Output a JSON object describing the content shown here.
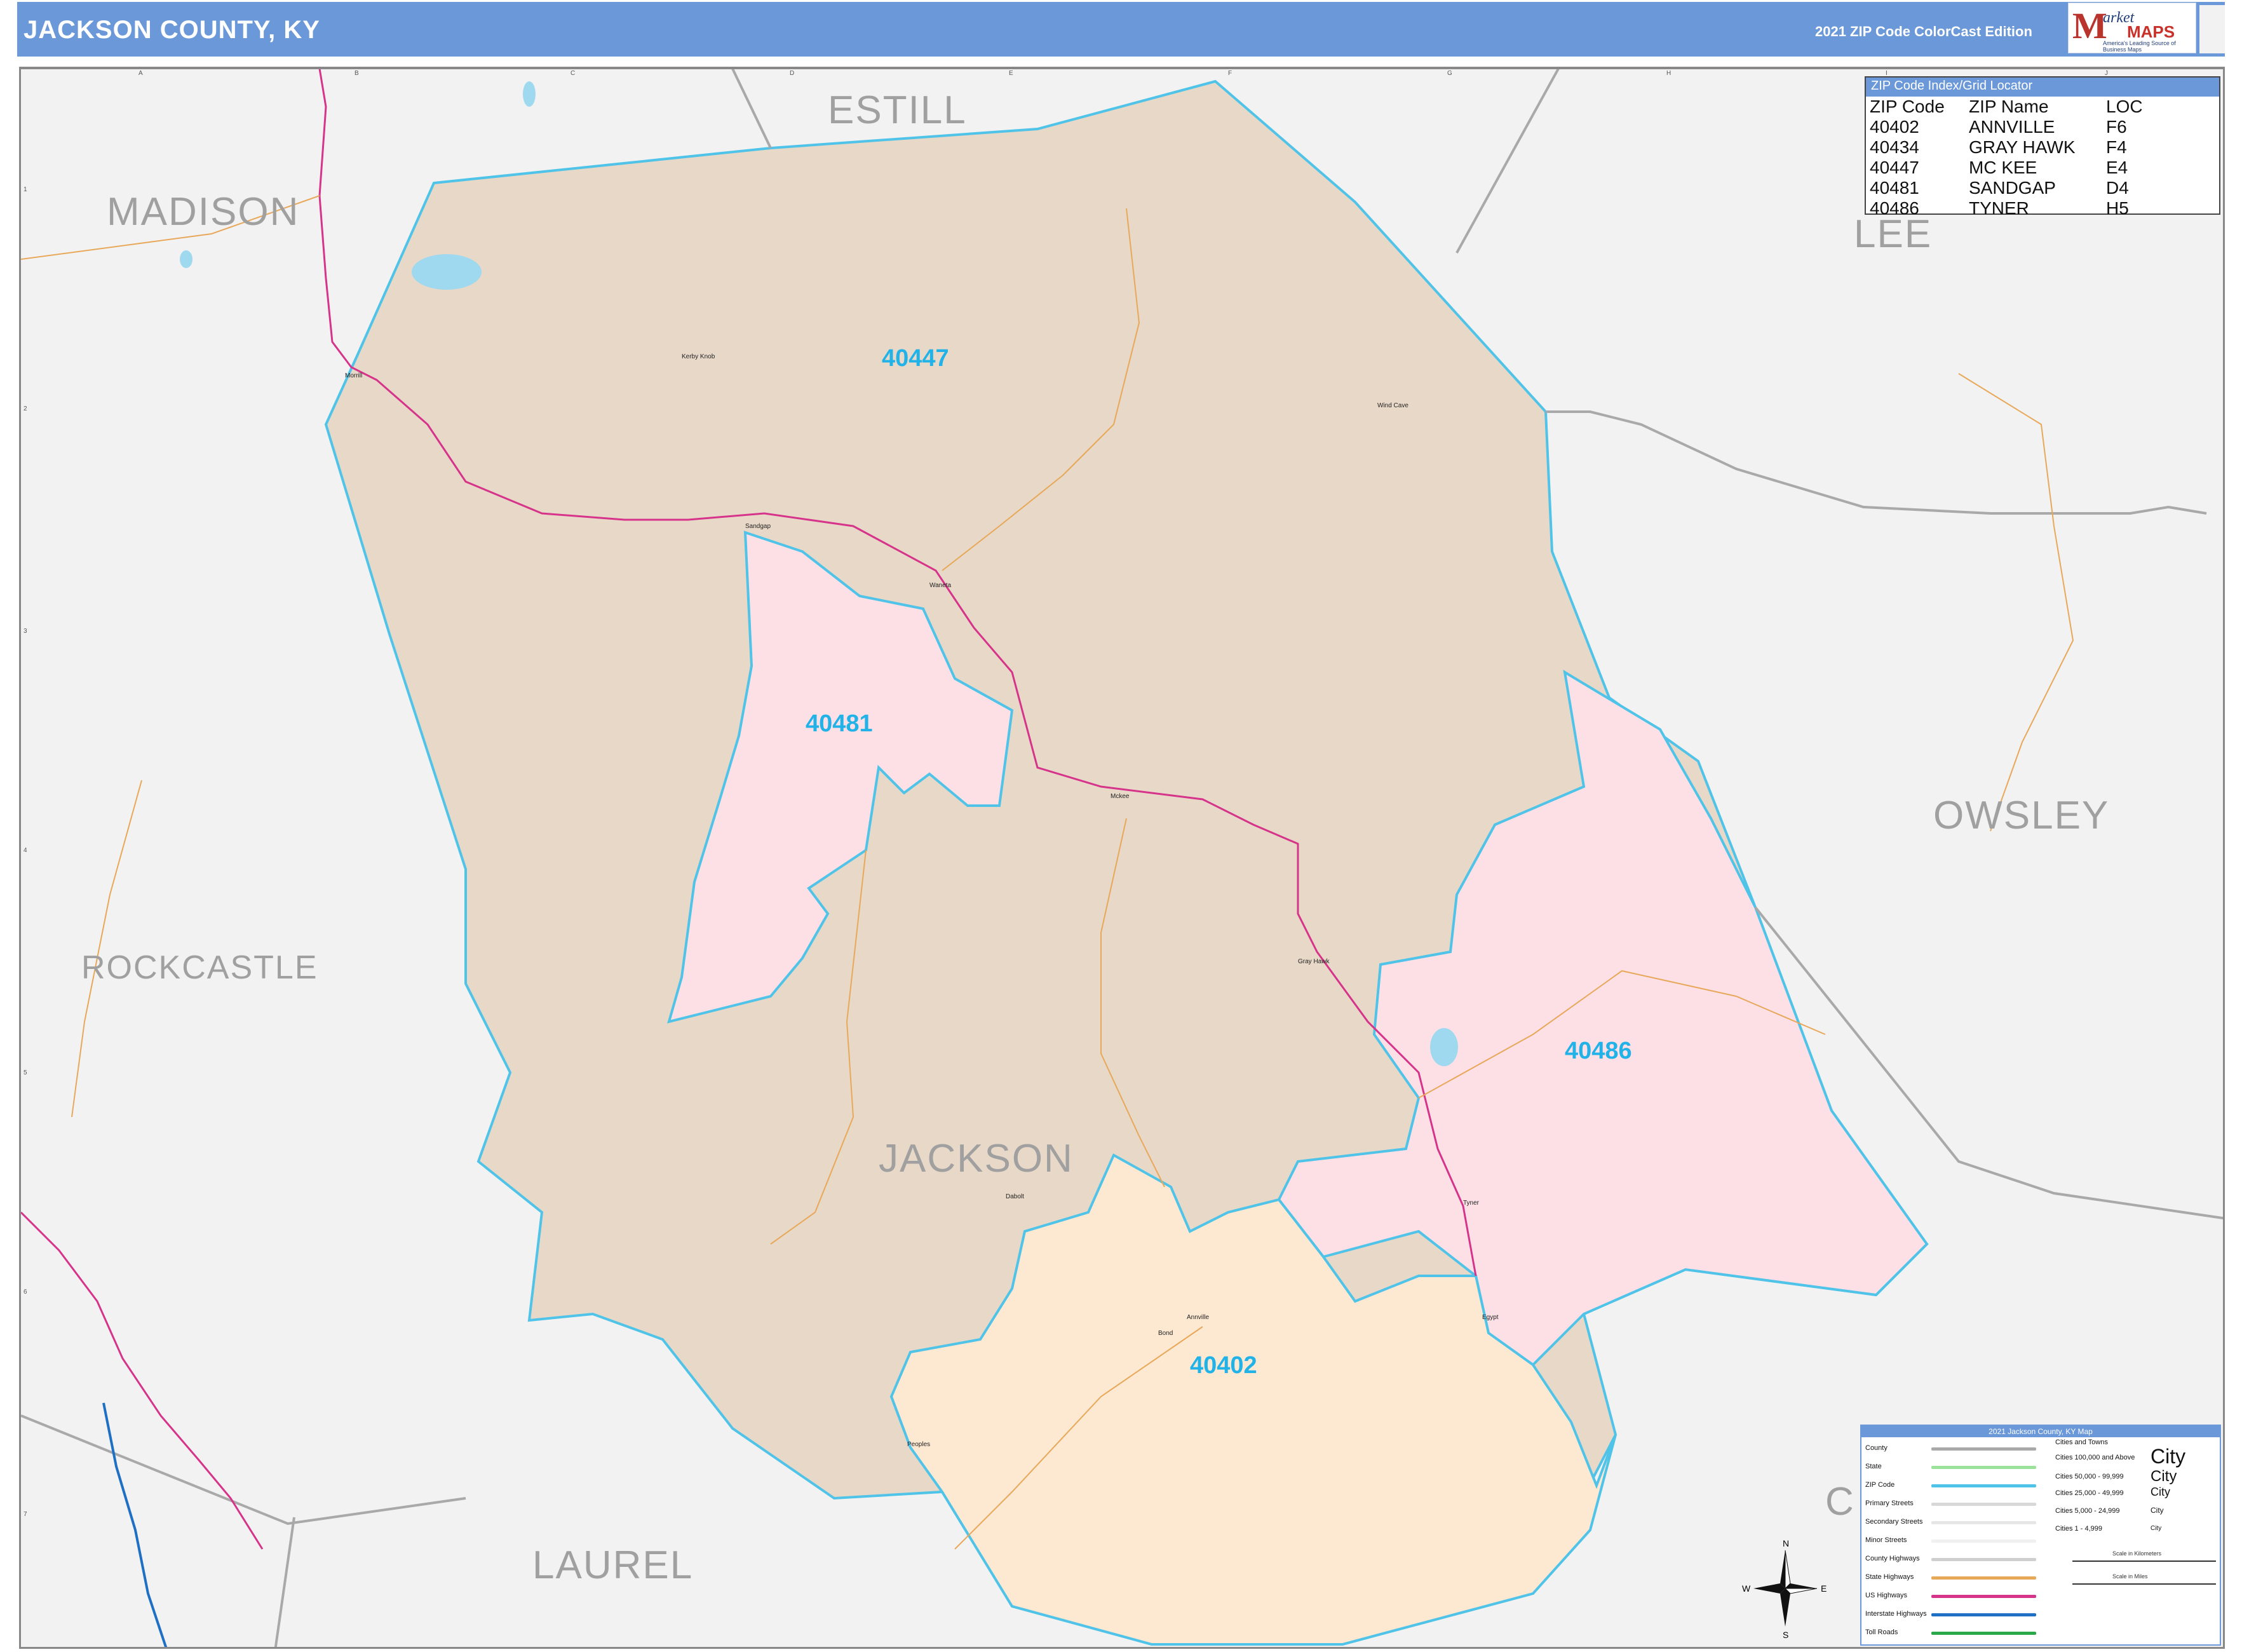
{
  "header": {
    "title": "JACKSON COUNTY, KY",
    "edition": "2021 ZIP Code ColorCast Edition",
    "logo_initial": "M",
    "logo_word1": "arket",
    "logo_word2": "MAPS",
    "logo_tagline": "America's Leading Source of Business Maps"
  },
  "grid": {
    "columns": [
      "A",
      "B",
      "C",
      "D",
      "E",
      "F",
      "G",
      "H",
      "I",
      "J"
    ],
    "rows": [
      "1",
      "2",
      "3",
      "4",
      "5",
      "6",
      "7"
    ]
  },
  "counties": {
    "jackson": "JACKSON",
    "madison": "MADISON",
    "estill": "ESTILL",
    "lee": "LEE",
    "owsley": "OWSLEY",
    "rockcastle": "ROCKCASTLE",
    "laurel": "LAUREL",
    "clay": "C"
  },
  "zips": [
    {
      "code": "40447",
      "name": "MC KEE",
      "color": "#e8d8c8"
    },
    {
      "code": "40481",
      "name": "SANDGAP",
      "color": "#fde0e6"
    },
    {
      "code": "40486",
      "name": "TYNER",
      "color": "#fde0e6"
    },
    {
      "code": "40402",
      "name": "ANNVILLE",
      "color": "#fde8d2"
    }
  ],
  "places": {
    "kerby_knob": "Kerby Knob",
    "wind_cave": "Wind Cave",
    "sandgap": "Sandgap",
    "waneta": "Waneta",
    "mckee": "Mckee",
    "gray_hawk": "Gray Hawk",
    "tyner": "Tyner",
    "egypt": "Egypt",
    "annville": "Annville",
    "bond": "Bond",
    "dabolt": "Dabolt",
    "peoples": "Peoples",
    "morrill": "Morrill"
  },
  "zip_index": {
    "title": "ZIP Code Index/Grid Locator",
    "headers": [
      "ZIP Code",
      "ZIP Name",
      "LOC"
    ],
    "rows": [
      [
        "40402",
        "ANNVILLE",
        "F6"
      ],
      [
        "40434",
        "GRAY HAWK",
        "F4"
      ],
      [
        "40447",
        "MC KEE",
        "E4"
      ],
      [
        "40481",
        "SANDGAP",
        "D4"
      ],
      [
        "40486",
        "TYNER",
        "H5"
      ]
    ]
  },
  "legend": {
    "title": "2021 Jackson County, KY Map",
    "items": [
      {
        "label": "County",
        "color": "#a9a9a9"
      },
      {
        "label": "State",
        "color": "#9be39b"
      },
      {
        "label": "ZIP Code",
        "color": "#4fc3e8"
      },
      {
        "label": "Primary Streets",
        "color": "#d8d8d8"
      },
      {
        "label": "Secondary Streets",
        "color": "#e6e6e6"
      },
      {
        "label": "Minor Streets",
        "color": "#f0f0f0"
      },
      {
        "label": "County Highways",
        "color": "#cfcfcf"
      },
      {
        "label": "State Highways",
        "color": "#e8a85a"
      },
      {
        "label": "US Highways",
        "color": "#d6338a"
      },
      {
        "label": "Interstate Highways",
        "color": "#1f6fc4"
      },
      {
        "label": "Toll Roads",
        "color": "#2aa84a"
      }
    ],
    "cities_title": "Cities and Towns",
    "cities": [
      {
        "label": "Cities 100,000 and Above",
        "sample": "City"
      },
      {
        "label": "Cities 50,000 - 99,999",
        "sample": "City"
      },
      {
        "label": "Cities 25,000 - 49,999",
        "sample": "City"
      },
      {
        "label": "Cities 5,000 - 24,999",
        "sample": "City"
      },
      {
        "label": "Cities 1 - 4,999",
        "sample": "City"
      }
    ],
    "scale_km": "Scale in Kilometers",
    "scale_mi": "Scale in Miles"
  },
  "compass": {
    "n": "N",
    "s": "S",
    "e": "E",
    "w": "W"
  },
  "colors": {
    "header": "#6a98d8",
    "zip_boundary": "#4fc3e8",
    "zip_label": "#21b3e8",
    "us_highway": "#d6338a",
    "state_highway": "#e8a85a",
    "interstate": "#1f6fc4"
  }
}
